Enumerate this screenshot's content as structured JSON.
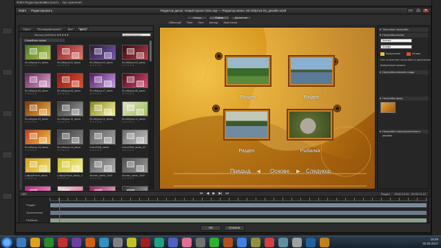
{
  "bg": {
    "top_items": [
      "Файл",
      "Редактировать",
      "Настроить",
      "Зал хранения"
    ]
  },
  "titlebar": {
    "title": "Редактор диска: Новый проект Disc.axp — Редактор меню: 50-обёртка-03_дизайн-16х9",
    "menu": [
      "Файл",
      "Редактировать"
    ],
    "buttons": [
      "—",
      "▢",
      "✕"
    ]
  },
  "modebar": {
    "tabs": [
      "Назад",
      "Стиль",
      "Движение"
    ],
    "views": [
      "Обычный",
      "Тень",
      "Угол",
      "Контур",
      "Мои стили"
    ]
  },
  "library": {
    "tabs": [
      "Посл.",
      "Последний проект",
      "Все",
      "(ист.)"
    ],
    "filter_label": "Фильтр рейтинга ★★★★★",
    "search_placeholder": "Быстрый поиск",
    "category": "Семейные меню",
    "templates": [
      {
        "name": "50-обёртка-01_меню",
        "stars": "★★★★★",
        "c1": "#4d7a2a",
        "c2": "#b5c44a"
      },
      {
        "name": "50-обёртка-02_меню",
        "stars": "★★★★★",
        "c1": "#8a1f2a",
        "c2": "#e07a6a"
      },
      {
        "name": "50-обёртка-03_меню",
        "stars": "★★★★★",
        "c1": "#2a1a3a",
        "c2": "#7a5ab0"
      },
      {
        "name": "50-обёртка-04_меню",
        "stars": "★★★★★",
        "c1": "#3a0a10",
        "c2": "#b0404a"
      },
      {
        "name": "50-обёртка-05_меню",
        "stars": "★★★★★",
        "c1": "#6a2a5a",
        "c2": "#e0a0d0"
      },
      {
        "name": "50-обёртка-06_меню",
        "stars": "★★★★★",
        "c1": "#8a1a1a",
        "c2": "#e05030"
      },
      {
        "name": "50-обёртка-07_меню",
        "stars": "★★★★★",
        "c1": "#5a1a6a",
        "c2": "#c0a0e0"
      },
      {
        "name": "50-обёртка-08_меню",
        "stars": "★★★★★",
        "c1": "#4a0a1a",
        "c2": "#d05070"
      },
      {
        "name": "50-обёртка-09_меню",
        "stars": "★★★★★",
        "c1": "#7a3a0a",
        "c2": "#f0b040"
      },
      {
        "name": "50-обёртка-10_меню",
        "stars": "★★★★★",
        "c1": "#3a3a3a",
        "c2": "#9a9a9a"
      },
      {
        "name": "50-обёртка-11_меню",
        "stars": "★★★★★",
        "c1": "#8a8a20",
        "c2": "#f0f0a0"
      },
      {
        "name": "50-обёртка-12_меню",
        "stars": "★★★★★",
        "c1": "#e0e0c0",
        "c2": "#a0c060"
      },
      {
        "name": "50-обёртка-13_меню",
        "stars": "★★★★★",
        "c1": "#c04020",
        "c2": "#f0c040"
      },
      {
        "name": "50-обёртка-14_меню",
        "stars": "★★★★★",
        "c1": "#404040",
        "c2": "#808080"
      },
      {
        "name": "GreenField_меню",
        "stars": "★★★★★",
        "c1": "#606060",
        "c2": "#a0a0a0"
      },
      {
        "name": "GreenField_меню_02",
        "stars": "★★★★★",
        "c1": "#707070",
        "c2": "#c0c0c0"
      },
      {
        "name": "LollipopFence_меню",
        "stars": "★★★★★",
        "c1": "#d0a020",
        "c2": "#f0e070"
      },
      {
        "name": "LollipopFence_меню_2",
        "stars": "★★★★★",
        "c1": "#d0c020",
        "c2": "#f0f0a0"
      },
      {
        "name": "Исключ_меню_16х9",
        "stars": "★★★★★",
        "c1": "#606060",
        "c2": "#b0b0b0"
      },
      {
        "name": "Исключ_меню_16х9",
        "stars": "★★★★★",
        "c1": "#505050",
        "c2": "#9a9a9a"
      },
      {
        "name": "Лето_меню",
        "stars": "★★★★★",
        "c1": "#c02080",
        "c2": "#f0a0d0"
      },
      {
        "name": "Лето_меню_02",
        "stars": "★★★★★",
        "c1": "#e0e0e0",
        "c2": "#f06090"
      },
      {
        "name": "Лето_меню_03",
        "stars": "★★★★★",
        "c1": "#a02060",
        "c2": "#e0c0d0"
      },
      {
        "name": "Лето_меню_04",
        "stars": "★★★★★",
        "c1": "#303030",
        "c2": "#b0b0b0"
      }
    ]
  },
  "preview": {
    "items": [
      {
        "caption": "Раздел",
        "pic": "linear-gradient(#9ab8c8 0 40%, #3a6a2a 40% 70%, #5a8a3a 70%)"
      },
      {
        "caption": "Раздел",
        "pic": "linear-gradient(#8ab0d0 0 45%, #4a5a3a 45% 55%, #5a7a9a 55%)"
      },
      {
        "caption": "Раздел",
        "pic": "linear-gradient(#c0c8b8 0 35%, #3a5a2a 35% 55%, #708aa0 55%)"
      },
      {
        "caption": "Рыбалка",
        "pic": "radial-gradient(circle at 45% 55%, #b0a8a0 0 28%, #5a6a30 30%, #3a4a20 100%)"
      }
    ],
    "nav": {
      "prev": "Предыд",
      "main": "Основн",
      "next": "Следующ"
    },
    "colors": {
      "bg_light": "#f2c24a",
      "bg_dark": "#8c4e08",
      "frame": "#7a3b0a"
    }
  },
  "props": {
    "section_text": "Текстовые настройки",
    "section_button": "Настройки кнопки",
    "field_style": "Кнопка",
    "field_font": "Альфа",
    "color_label": "Выбранный",
    "active_label": "Активн.",
    "use_as_label": "Исп. в качестве настройки по умолчанию",
    "linked_label": "Выбранный элемент",
    "section_view": "Настройка внешнего вида",
    "section_bg": "Настройки фона",
    "section_aspect": "Настройки стереоскопического режима"
  },
  "timeline": {
    "timecode": "АВЗ",
    "controls": [
      "⏮",
      "◀",
      "▶",
      "▶|",
      "⏭"
    ],
    "mode": "Раздел",
    "time": "00:00:12.00 · 00:00:11.10",
    "tracks": [
      {
        "name": "Раздел",
        "color": "#7a8a9a"
      },
      {
        "name": "Заполнитель",
        "color": "#6a7a8a"
      },
      {
        "name": "Рыбалка",
        "color": "#8aa08a"
      }
    ]
  },
  "footer": {
    "ok": "OK",
    "cancel": "Отмена"
  },
  "taskbar": {
    "time": "15:09",
    "date": "02.06.2017",
    "apps": [
      "#3a7ac0",
      "#e0a020",
      "#2a8a2a",
      "#c03030",
      "#6a40a0",
      "#d06010",
      "#3090c0",
      "#808080",
      "#c0c020",
      "#a02020",
      "#20a080",
      "#5060c0",
      "#e07090",
      "#707070",
      "#30b030",
      "#b05020",
      "#4080e0",
      "#909040",
      "#d04040",
      "#6090a0",
      "#a0a0a0",
      "#2060a0",
      "#c08020"
    ]
  }
}
